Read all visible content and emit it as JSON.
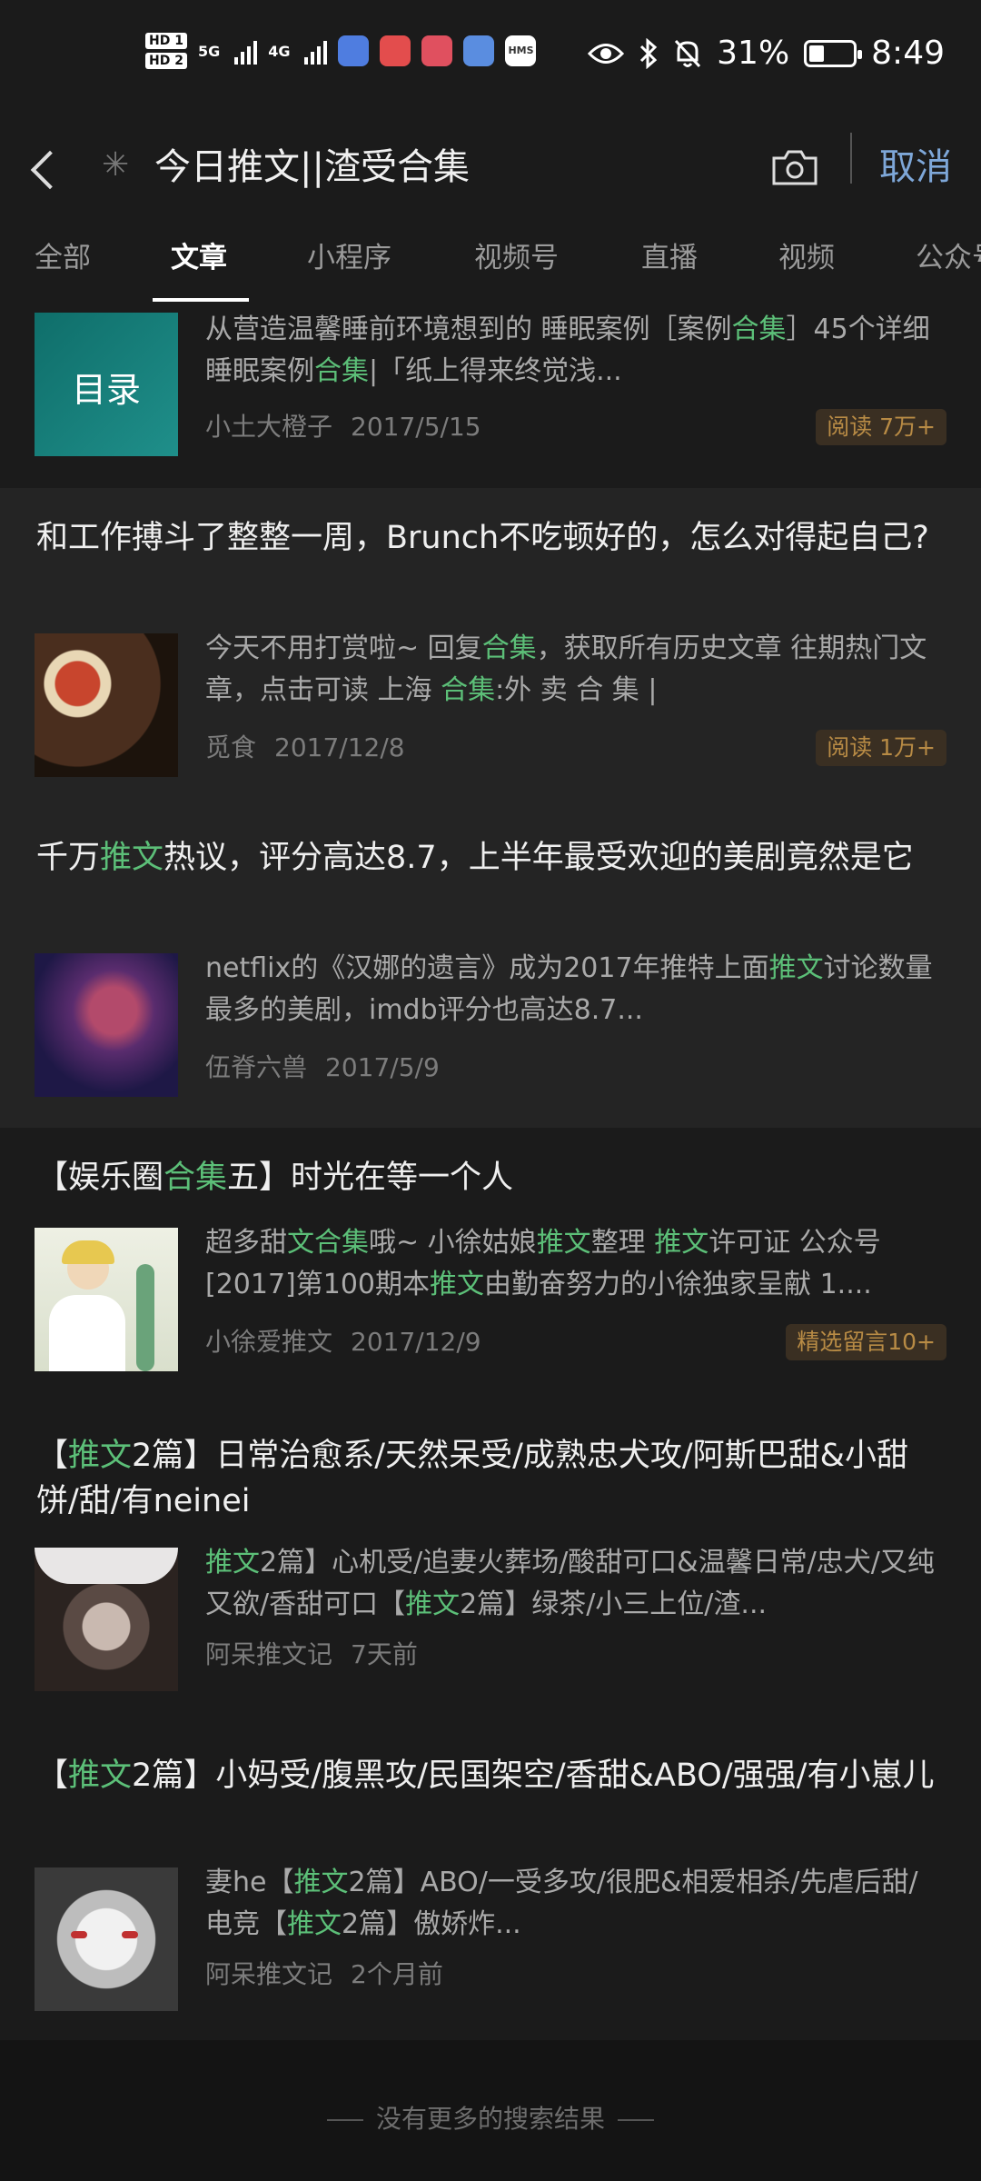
{
  "status_bar": {
    "hd1": "HD 1",
    "hd2": "HD 2",
    "net1": "5G",
    "net2": "4G",
    "battery": "31%",
    "time": "8:49",
    "icons": [
      "eye-icon",
      "bluetooth-icon",
      "mute-bell-icon",
      "battery-icon"
    ]
  },
  "search_bar": {
    "query": "今日推文||渣受合集",
    "cancel_label": "取消"
  },
  "tabs": [
    "全部",
    "文章",
    "小程序",
    "视频号",
    "直播",
    "视频",
    "公众号"
  ],
  "active_tab": "文章",
  "results": [
    {
      "thumb_text": "目录",
      "snippet": [
        [
          "从营造温馨睡前环境想到的 睡眠案例［案例",
          ""
        ],
        [
          "合集",
          "hl"
        ],
        [
          "］45个详细睡眠案例",
          ""
        ],
        [
          "合集",
          "hl"
        ],
        [
          "|「纸上得来终觉浅...",
          ""
        ]
      ],
      "source": "小土大橙子",
      "date": "2017/5/15",
      "badge": "阅读 7万+"
    },
    {
      "title": [
        [
          "和工作搏斗了整整一周，Brunch不吃顿好的，怎么对得起自己?",
          ""
        ]
      ],
      "snippet": [
        [
          "今天不用打赏啦~ 回复",
          ""
        ],
        [
          "合集",
          "hl"
        ],
        [
          "，获取所有历史文章 往期热门文章，点击可读 上海 ",
          ""
        ],
        [
          "合集",
          "hl"
        ],
        [
          ":外 卖 合 集 |",
          ""
        ]
      ],
      "source": "觅食",
      "date": "2017/12/8",
      "badge": "阅读 1万+"
    },
    {
      "title": [
        [
          "千万",
          ""
        ],
        [
          "推文",
          "hl"
        ],
        [
          "热议，评分高达8.7，上半年最受欢迎的美剧竟然是它",
          ""
        ]
      ],
      "snippet": [
        [
          "netflix的《汉娜的遗言》成为2017年推特上面",
          ""
        ],
        [
          "推文",
          "hl"
        ],
        [
          "讨论数量最多的美剧，imdb评分也高达8.7...",
          ""
        ]
      ],
      "source": "伍脊六兽",
      "date": "2017/5/9",
      "badge": ""
    },
    {
      "title": [
        [
          "【娱乐圈",
          ""
        ],
        [
          "合集",
          "hl"
        ],
        [
          "五】时光在等一个人",
          ""
        ]
      ],
      "snippet": [
        [
          "超多甜",
          ""
        ],
        [
          "文合集",
          "hl"
        ],
        [
          "哦~ 小徐姑娘",
          ""
        ],
        [
          "推文",
          "hl"
        ],
        [
          "整理 ",
          ""
        ],
        [
          "推文",
          "hl"
        ],
        [
          "许可证 公众号[2017]第100期本",
          ""
        ],
        [
          "推文",
          "hl"
        ],
        [
          "由勤奋努力的小徐独家呈献 1....",
          ""
        ]
      ],
      "source": "小徐爱推文",
      "date": "2017/12/9",
      "badge": "精选留言10+"
    },
    {
      "title": [
        [
          "【",
          ""
        ],
        [
          "推文",
          "hl"
        ],
        [
          "2篇】日常治愈系/天然呆受/成熟忠犬攻/阿斯巴甜&小甜饼/甜/有neinei",
          ""
        ]
      ],
      "snippet": [
        [
          "推文",
          "hl"
        ],
        [
          "2篇】心机受/追妻火葬场/酸甜可口&温馨日常/忠犬/又纯又欲/香甜可口【",
          ""
        ],
        [
          "推文",
          "hl"
        ],
        [
          "2篇】绿茶/小三上位/渣...",
          ""
        ]
      ],
      "source": "阿呆推文记",
      "date": "7天前",
      "badge": ""
    },
    {
      "title": [
        [
          "【",
          ""
        ],
        [
          "推文",
          "hl"
        ],
        [
          "2篇】小妈受/腹黑攻/民国架空/香甜&ABO/强强/有小崽儿",
          ""
        ]
      ],
      "snippet": [
        [
          "妻he【",
          ""
        ],
        [
          "推文",
          "hl"
        ],
        [
          "2篇】ABO/一受多攻/很肥&相爱相杀/先虐后甜/电竞【",
          ""
        ],
        [
          "推文",
          "hl"
        ],
        [
          "2篇】傲娇炸...",
          ""
        ]
      ],
      "source": "阿呆推文记",
      "date": "2个月前",
      "badge": ""
    }
  ],
  "footer": "没有更多的搜索结果",
  "colors": {
    "highlight": "#5cbf78",
    "cancel": "#7ea7d8",
    "badge": "#b88b45",
    "background": "#1b1b1b"
  }
}
